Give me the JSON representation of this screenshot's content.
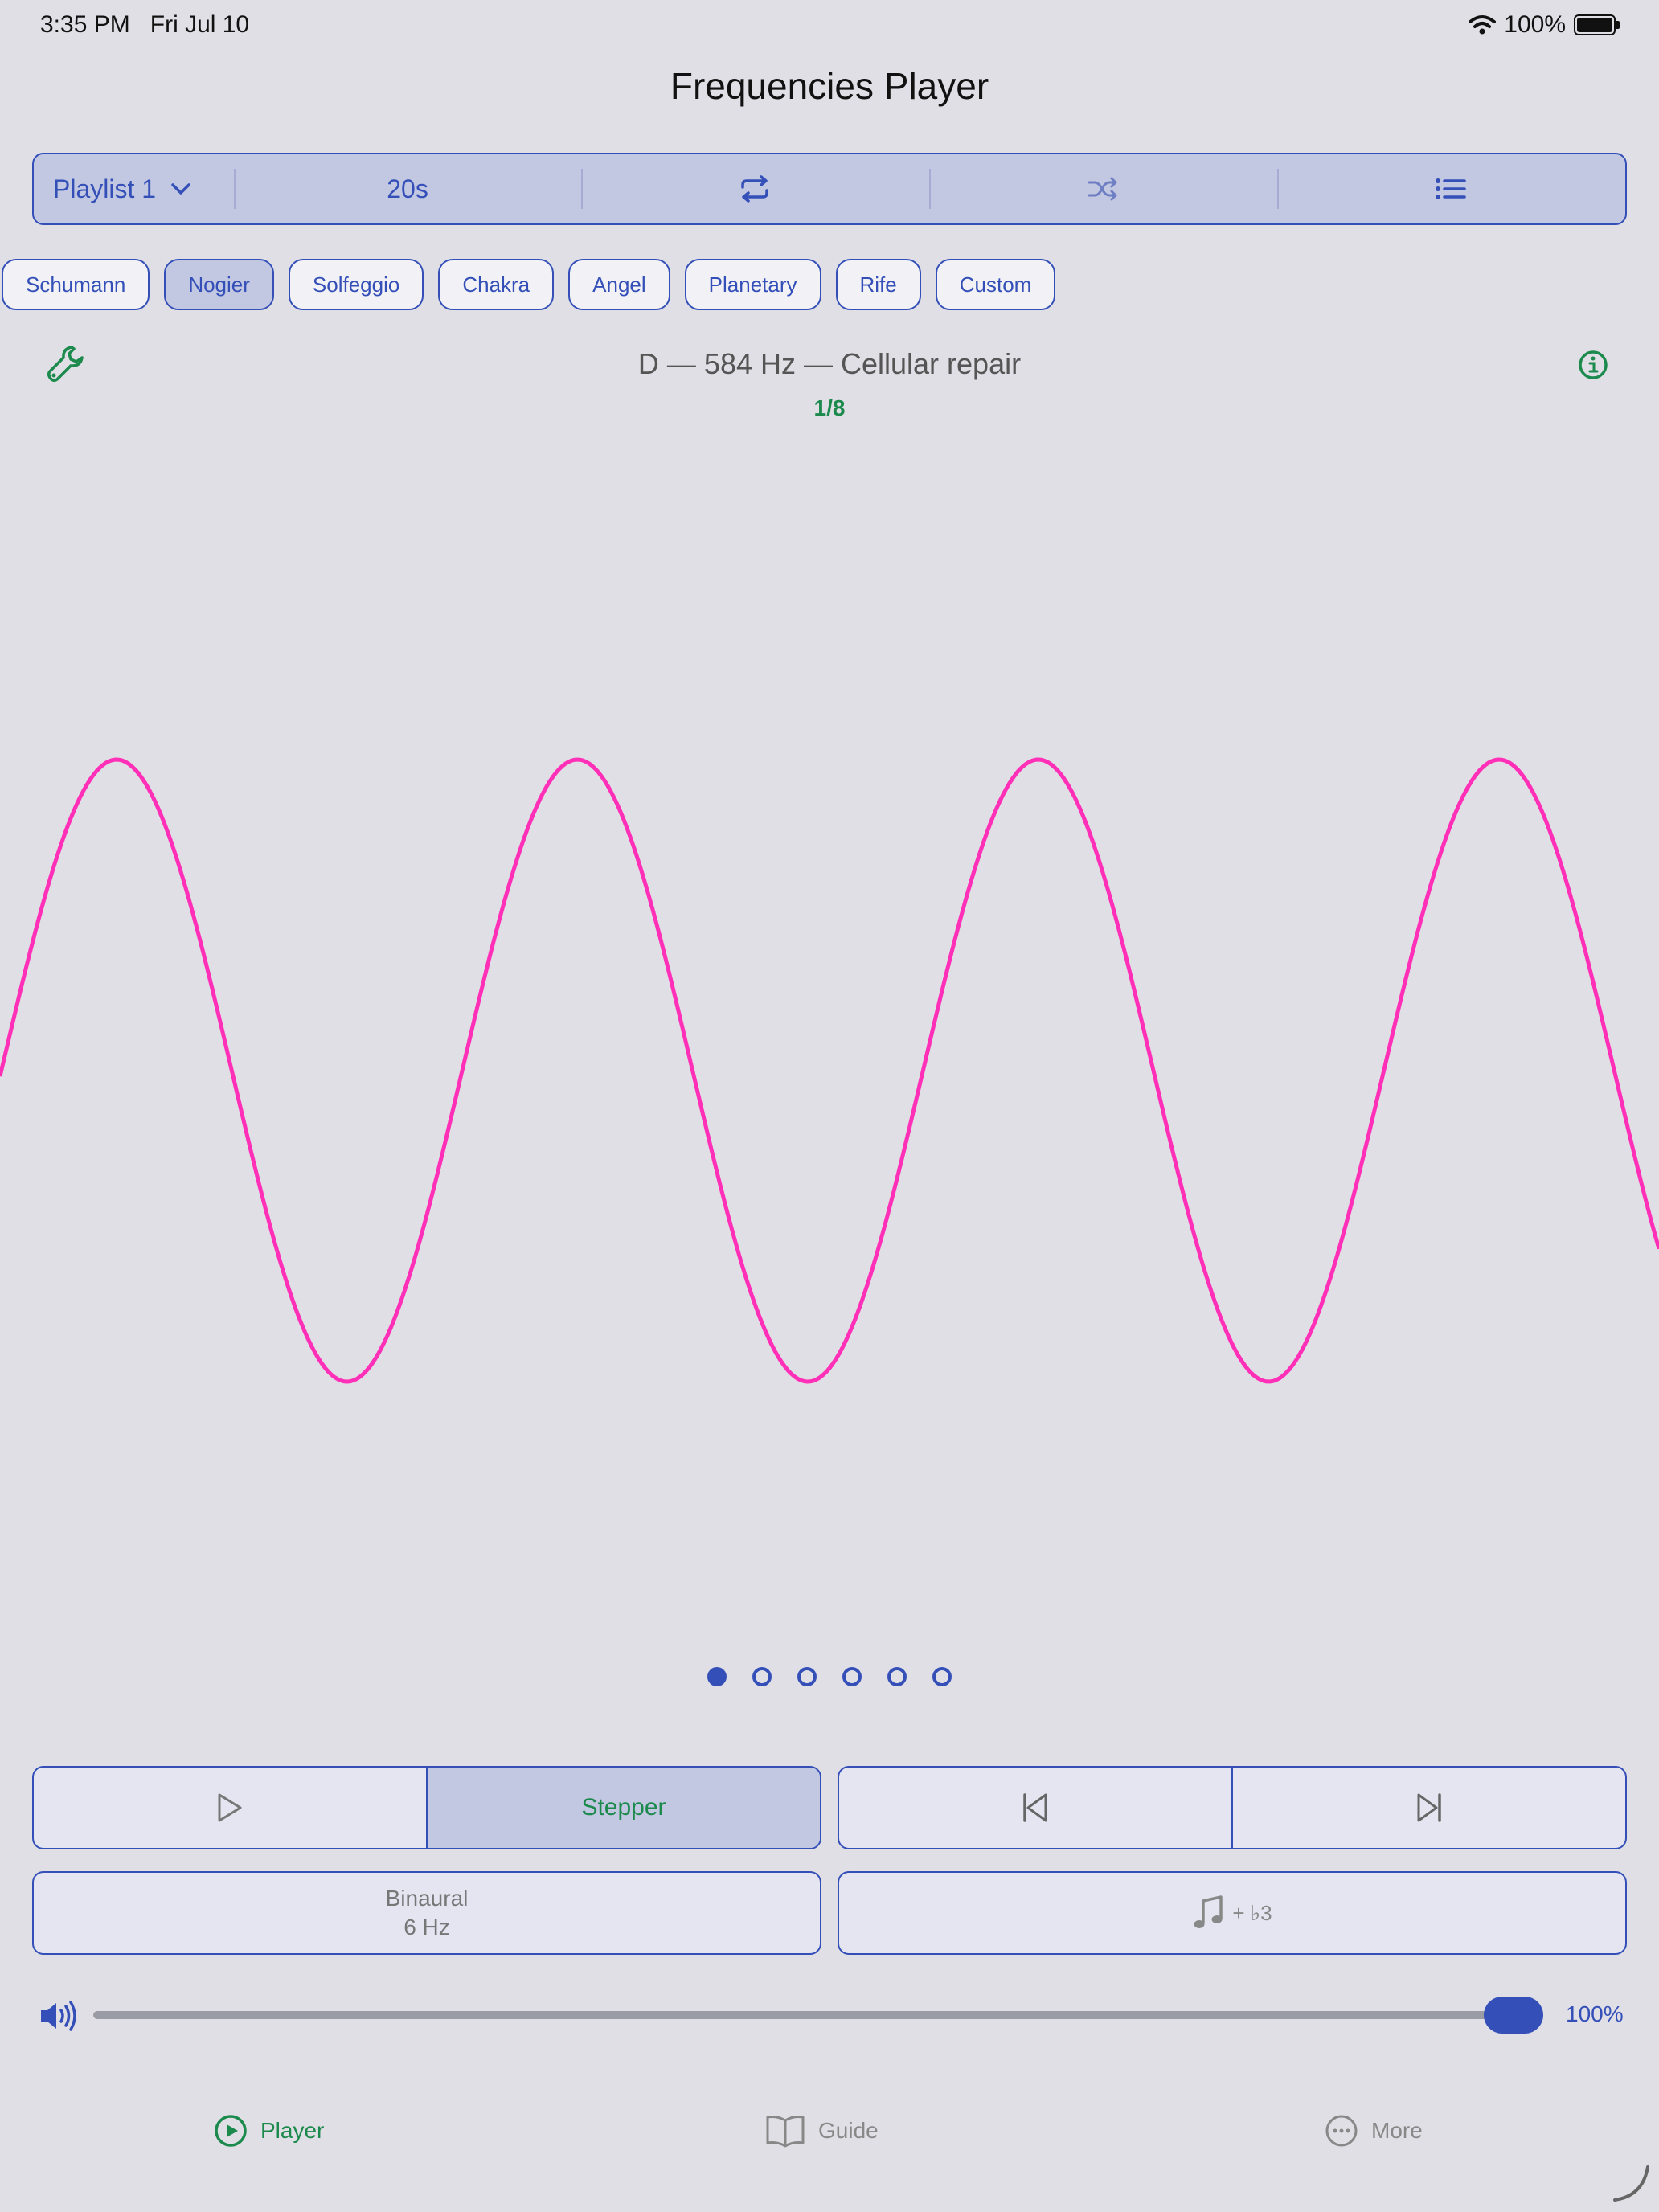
{
  "status": {
    "time": "3:35 PM",
    "date": "Fri Jul 10",
    "battery": "100%"
  },
  "header": {
    "title": "Frequencies Player"
  },
  "toolbar": {
    "playlist": "Playlist 1",
    "duration": "20s"
  },
  "categories": [
    "Schumann",
    "Nogier",
    "Solfeggio",
    "Chakra",
    "Angel",
    "Planetary",
    "Rife",
    "Custom"
  ],
  "selected_category": "Nogier",
  "frequency": {
    "title": "D — 584 Hz — Cellular repair",
    "position": "1/8"
  },
  "waveform": {
    "color": "#ff2fb7",
    "cycles_visible": 3.6
  },
  "pager": {
    "count": 6,
    "active_index": 0
  },
  "controls": {
    "mode_label": "Stepper",
    "binaural_label": "Binaural",
    "binaural_value": "6 Hz",
    "chord_label": "+ ♭3"
  },
  "volume": {
    "percent_label": "100%",
    "level": 1.0
  },
  "tabs": {
    "player": "Player",
    "guide": "Guide",
    "more": "More"
  },
  "colors": {
    "accent": "#3450b8",
    "green": "#1b8a4c",
    "wave": "#ff2fb7",
    "background": "#e0dfe5"
  }
}
